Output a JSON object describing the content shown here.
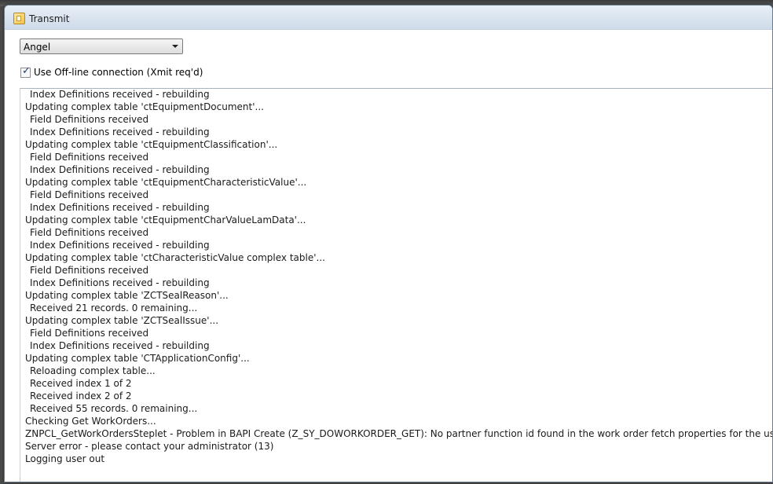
{
  "window": {
    "title": "Transmit",
    "icon": "transmit-app-icon"
  },
  "connection": {
    "selected_profile": "Angel",
    "offline_checked": true,
    "offline_label": "Use Off-line connection (Xmit req'd)"
  },
  "log": [
    {
      "text": "Index Definitions received - rebuilding",
      "indent": true
    },
    {
      "text": "Updating complex table 'ctEquipmentDocument'...",
      "indent": false
    },
    {
      "text": "Field Definitions received",
      "indent": true
    },
    {
      "text": "Index Definitions received - rebuilding",
      "indent": true
    },
    {
      "text": "Updating complex table 'ctEquipmentClassification'...",
      "indent": false
    },
    {
      "text": "Field Definitions received",
      "indent": true
    },
    {
      "text": "Index Definitions received - rebuilding",
      "indent": true
    },
    {
      "text": "Updating complex table 'ctEquipmentCharacteristicValue'...",
      "indent": false
    },
    {
      "text": "Field Definitions received",
      "indent": true
    },
    {
      "text": "Index Definitions received - rebuilding",
      "indent": true
    },
    {
      "text": "Updating complex table 'ctEquipmentCharValueLamData'...",
      "indent": false
    },
    {
      "text": "Field Definitions received",
      "indent": true
    },
    {
      "text": "Index Definitions received - rebuilding",
      "indent": true
    },
    {
      "text": "Updating complex table 'ctCharacteristicValue complex table'...",
      "indent": false
    },
    {
      "text": "Field Definitions received",
      "indent": true
    },
    {
      "text": "Index Definitions received - rebuilding",
      "indent": true
    },
    {
      "text": "Updating complex table 'ZCTSealReason'...",
      "indent": false
    },
    {
      "text": "Received 21 records. 0 remaining...",
      "indent": true
    },
    {
      "text": "Updating complex table 'ZCTSealIssue'...",
      "indent": false
    },
    {
      "text": "Field Definitions received",
      "indent": true
    },
    {
      "text": "Index Definitions received - rebuilding",
      "indent": true
    },
    {
      "text": "Updating complex table 'CTApplicationConfig'...",
      "indent": false
    },
    {
      "text": "Reloading complex table...",
      "indent": true
    },
    {
      "text": "Received index 1 of 2",
      "indent": true
    },
    {
      "text": "Received index 2 of 2",
      "indent": true
    },
    {
      "text": "Received 55 records. 0 remaining...",
      "indent": true
    },
    {
      "text": "Checking Get WorkOrders...",
      "indent": false
    },
    {
      "text": "ZNPCL_GetWorkOrdersSteplet - Problem in BAPI Create (Z_SY_DOWORKORDER_GET): No partner function id found in the work order fetch properties for the user",
      "indent": false,
      "redacted": true
    },
    {
      "text": "Server error - please contact your administrator (13)",
      "indent": false
    },
    {
      "text": "Logging user out",
      "indent": false
    }
  ]
}
